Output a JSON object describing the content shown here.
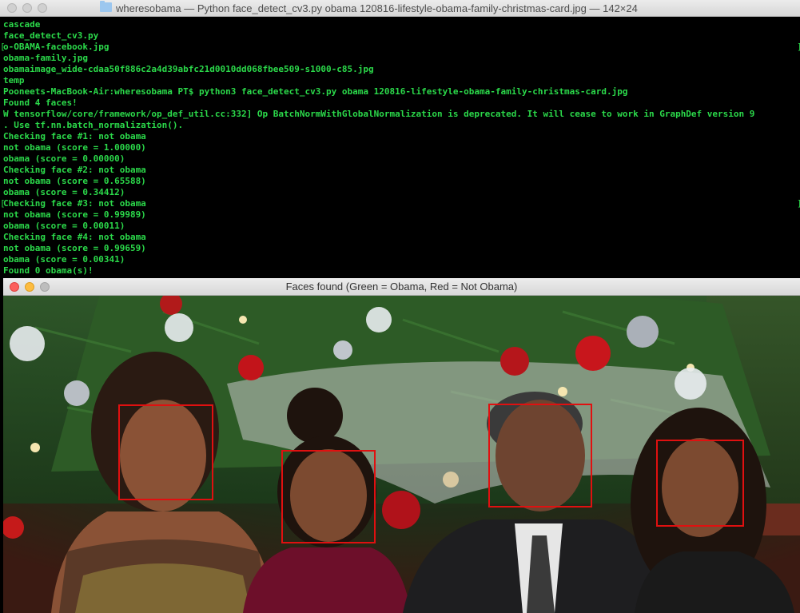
{
  "terminal": {
    "title": "wheresobama — Python face_detect_cv3.py obama 120816-lifestyle-obama-family-christmas-card.jpg — 142×24",
    "lines": [
      "cascade",
      "face_detect_cv3.py",
      "o-OBAMA-facebook.jpg",
      "obama-family.jpg",
      "obamaimage_wide-cdaa50f886c2a4d39abfc21d0010dd068fbee509-s1000-c85.jpg",
      "temp",
      "Pooneets-MacBook-Air:wheresobama PT$ python3 face_detect_cv3.py obama 120816-lifestyle-obama-family-christmas-card.jpg",
      "Found 4 faces!",
      "W tensorflow/core/framework/op_def_util.cc:332] Op BatchNormWithGlobalNormalization is deprecated. It will cease to work in GraphDef version 9",
      ". Use tf.nn.batch_normalization().",
      "Checking face #1: not obama",
      "not obama (score = 1.00000)",
      "obama (score = 0.00000)",
      "Checking face #2: not obama",
      "not obama (score = 0.65588)",
      "obama (score = 0.34412)",
      "Checking face #3: not obama",
      "not obama (score = 0.99989)",
      "obama (score = 0.00011)",
      "Checking face #4: not obama",
      "not obama (score = 0.99659)",
      "obama (score = 0.00341)",
      "Found 0 obama(s)!"
    ],
    "text_color": "#2bd94a"
  },
  "image_window": {
    "title": "Faces found (Green = Obama, Red = Not Obama)",
    "box_color": "#e01010"
  }
}
